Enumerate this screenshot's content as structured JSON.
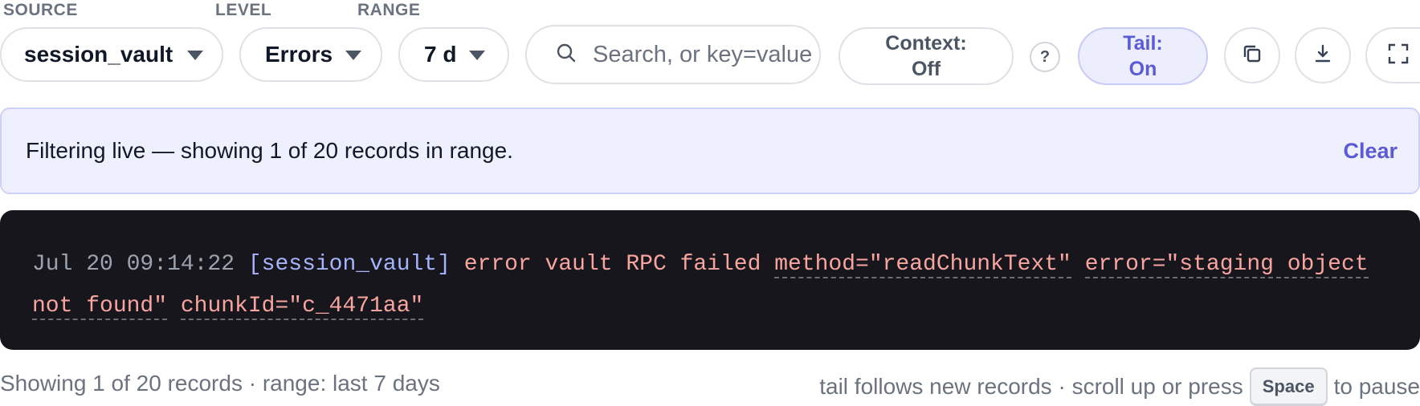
{
  "filters": {
    "source": {
      "label": "SOURCE",
      "value": "session_vault"
    },
    "level": {
      "label": "LEVEL",
      "value": "Errors"
    },
    "range": {
      "label": "RANGE",
      "value": "7 d"
    }
  },
  "search": {
    "placeholder": "Search, or key=value",
    "value": ""
  },
  "toolbar": {
    "context_line1": "Context:",
    "context_line2": "Off",
    "help": "?",
    "tail_line1": "Tail:",
    "tail_line2": "On"
  },
  "icons": {
    "search": "search-icon",
    "copy": "copy-icon",
    "download": "download-icon",
    "fullscreen": "fullscreen-icon"
  },
  "banner": {
    "message": "Filtering live — showing 1 of 20 records in range.",
    "clear": "Clear"
  },
  "log": {
    "timestamp": "Jul 20 09:14:22",
    "source": "[session_vault]",
    "message": "error vault RPC failed",
    "fields": [
      "method=\"readChunkText\"",
      "error=\"staging object not found\"",
      "chunkId=\"c_4471aa\""
    ]
  },
  "footer": {
    "left": "Showing 1 of 20 records · range: last 7 days",
    "right_before": "tail follows new records · scroll up or press",
    "key": "Space",
    "right_after": "to pause"
  },
  "colors": {
    "accent": "#5b5bd6",
    "tail_bg": "#eceefe",
    "banner_bg": "#eff0fd",
    "log_bg": "#17161c",
    "log_error": "#f8a5a0",
    "log_source": "#a5b4fc"
  }
}
